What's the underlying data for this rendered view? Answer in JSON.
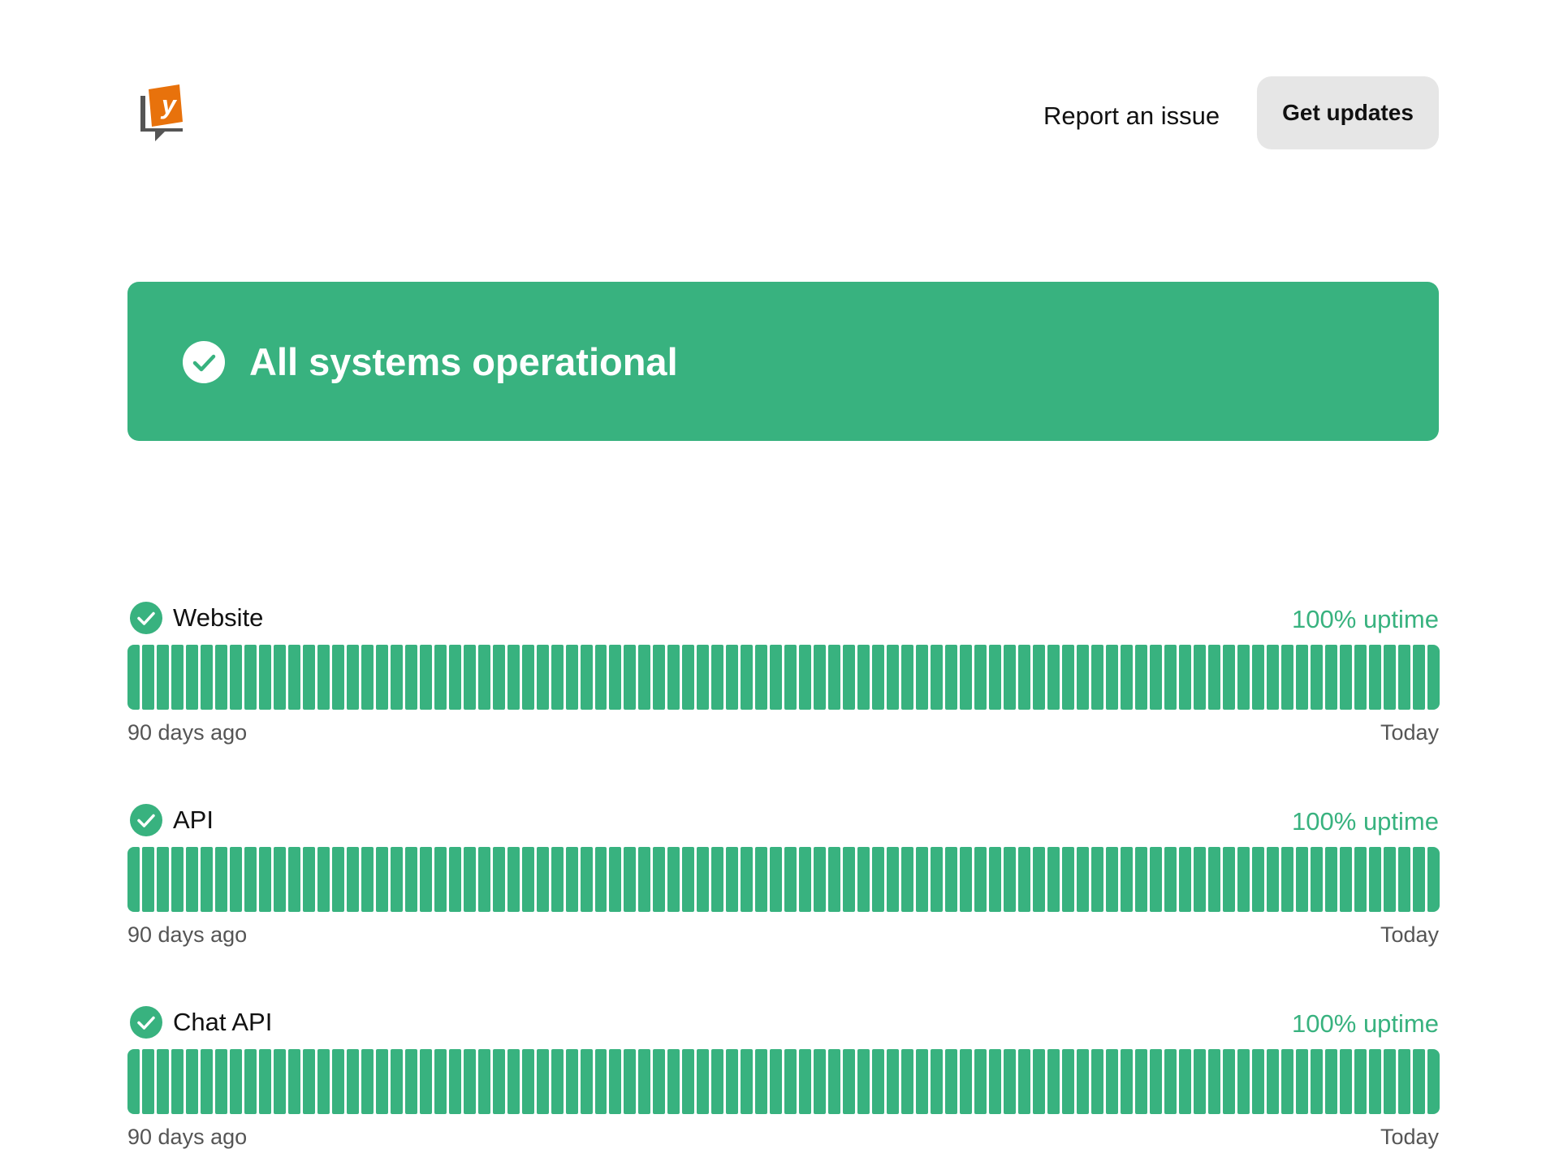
{
  "header": {
    "logo_icon": "yammer-style-logo-icon",
    "report_label": "Report an issue",
    "updates_label": "Get updates"
  },
  "banner": {
    "icon": "check-circle-icon",
    "title": "All systems operational",
    "color": "#38b27f"
  },
  "components": [
    {
      "name": "Website",
      "icon": "check-circle-icon",
      "uptime": "100% uptime",
      "days": 90,
      "range_start": "90 days ago",
      "range_end": "Today"
    },
    {
      "name": "API",
      "icon": "check-circle-icon",
      "uptime": "100% uptime",
      "days": 90,
      "range_start": "90 days ago",
      "range_end": "Today"
    },
    {
      "name": "Chat API",
      "icon": "check-circle-icon",
      "uptime": "100% uptime",
      "days": 90,
      "range_start": "90 days ago",
      "range_end": "Today"
    }
  ],
  "colors": {
    "operational": "#38b27f",
    "button_bg": "#e6e6e6",
    "logo_orange": "#e8720c",
    "logo_gray": "#555555"
  }
}
